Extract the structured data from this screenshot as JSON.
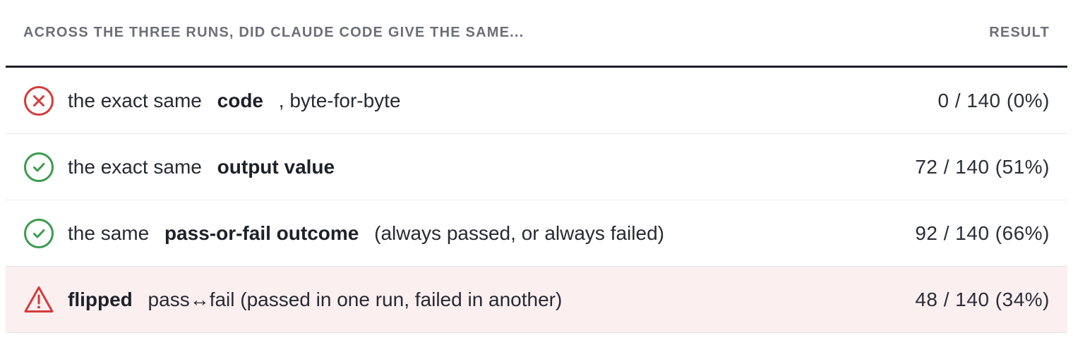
{
  "header": {
    "question": "Across the three runs, did Claude Code give the same...",
    "result": "Result"
  },
  "rows": [
    {
      "status": "fail",
      "icon": "x-circle-icon",
      "icon_color": "#d43b3b",
      "prefix": "the exact same",
      "emphasis": "code",
      "suffix": ", byte-for-byte",
      "result": "0 / 140 (0%)"
    },
    {
      "status": "pass",
      "icon": "check-circle-icon",
      "icon_color": "#3c9c4e",
      "prefix": "the exact same",
      "emphasis": "output value",
      "suffix": "",
      "result": "72 / 140 (51%)"
    },
    {
      "status": "pass",
      "icon": "check-circle-icon",
      "icon_color": "#3c9c4e",
      "prefix": "the same",
      "emphasis": "pass-or-fail outcome",
      "suffix": "(always passed, or always failed)",
      "result": "92 / 140 (66%)"
    },
    {
      "status": "warning",
      "icon": "warning-triangle-icon",
      "icon_color": "#d43b3b",
      "prefix": "",
      "emphasis": "flipped",
      "suffix": "pass↔fail (passed in one run, failed in another)",
      "result": "48 / 140 (34%)"
    }
  ],
  "colors": {
    "header_text": "#6b6f78",
    "warning_row_bg": "#fbeff0",
    "rule": "#1c1f26"
  }
}
